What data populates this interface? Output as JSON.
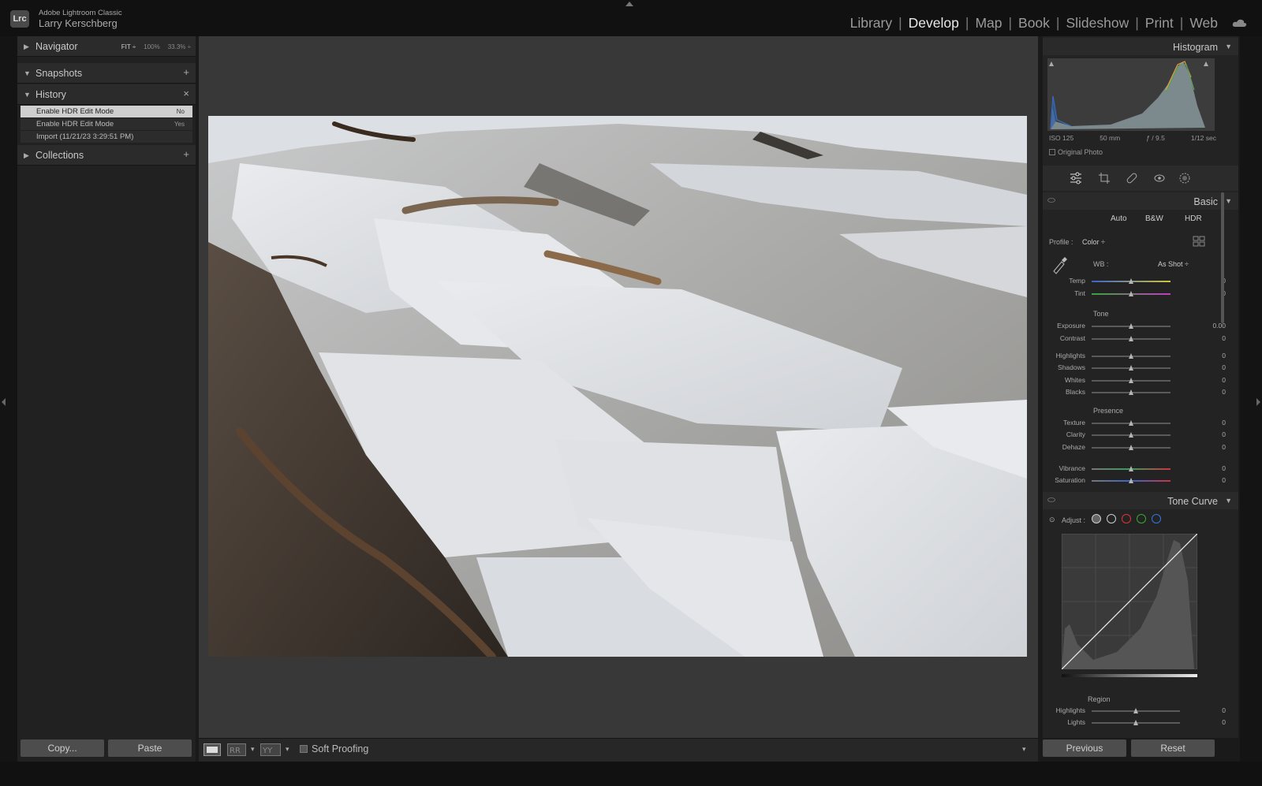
{
  "app": {
    "logo": "Lrc",
    "product": "Adobe Lightroom Classic",
    "user": "Larry Kerschberg"
  },
  "modules": [
    {
      "label": "Library",
      "active": false
    },
    {
      "label": "Develop",
      "active": true
    },
    {
      "label": "Map",
      "active": false
    },
    {
      "label": "Book",
      "active": false
    },
    {
      "label": "Slideshow",
      "active": false
    },
    {
      "label": "Print",
      "active": false
    },
    {
      "label": "Web",
      "active": false
    }
  ],
  "left": {
    "navigator": {
      "title": "Navigator",
      "fit": "FIT ÷",
      "z100": "100%",
      "z33": "33.3% ÷"
    },
    "snapshots": {
      "title": "Snapshots",
      "action": "+"
    },
    "history": {
      "title": "History",
      "action": "×",
      "items": [
        {
          "label": "Enable HDR Edit Mode",
          "value": "No"
        },
        {
          "label": "Enable HDR Edit Mode",
          "value": "Yes"
        },
        {
          "label": "Import (11/21/23 3:29:51 PM)",
          "value": ""
        }
      ]
    },
    "collections": {
      "title": "Collections",
      "action": "+"
    },
    "copy_label": "Copy...",
    "paste_label": "Paste"
  },
  "toolbar": {
    "soft_proofing": "Soft Proofing"
  },
  "right": {
    "histogram": {
      "title": "Histogram",
      "iso": "ISO 125",
      "focal": "50 mm",
      "aperture": "ƒ / 9.5",
      "shutter": "1/12 sec",
      "original_photo": "Original Photo"
    },
    "basic": {
      "title": "Basic",
      "auto": "Auto",
      "bw": "B&W",
      "hdr": "HDR",
      "profile_label": "Profile :",
      "profile_value": "Color ÷",
      "wb_label": "WB :",
      "wb_value": "As Shot ÷",
      "sections": {
        "tone": "Tone",
        "presence": "Presence"
      },
      "sliders": [
        {
          "label": "Temp",
          "value": "0",
          "pos": 0.5
        },
        {
          "label": "Tint",
          "value": "0",
          "pos": 0.5
        },
        {
          "label": "Exposure",
          "value": "0.00",
          "pos": 0.5
        },
        {
          "label": "Contrast",
          "value": "0",
          "pos": 0.5
        },
        {
          "label": "Highlights",
          "value": "0",
          "pos": 0.5
        },
        {
          "label": "Shadows",
          "value": "0",
          "pos": 0.5
        },
        {
          "label": "Whites",
          "value": "0",
          "pos": 0.5
        },
        {
          "label": "Blacks",
          "value": "0",
          "pos": 0.5
        },
        {
          "label": "Texture",
          "value": "0",
          "pos": 0.5
        },
        {
          "label": "Clarity",
          "value": "0",
          "pos": 0.5
        },
        {
          "label": "Dehaze",
          "value": "0",
          "pos": 0.5
        },
        {
          "label": "Vibrance",
          "value": "0",
          "pos": 0.5
        },
        {
          "label": "Saturation",
          "value": "0",
          "pos": 0.5
        }
      ]
    },
    "tone_curve": {
      "title": "Tone Curve",
      "adjust": "Adjust :",
      "region": "Region",
      "sliders": [
        {
          "label": "Highlights",
          "value": "0",
          "pos": 0.5
        },
        {
          "label": "Lights",
          "value": "0",
          "pos": 0.5
        }
      ]
    },
    "previous_label": "Previous",
    "reset_label": "Reset"
  },
  "colors": {
    "accent": "#e8e8e8",
    "panel": "#232323",
    "canvas": "#383838"
  }
}
